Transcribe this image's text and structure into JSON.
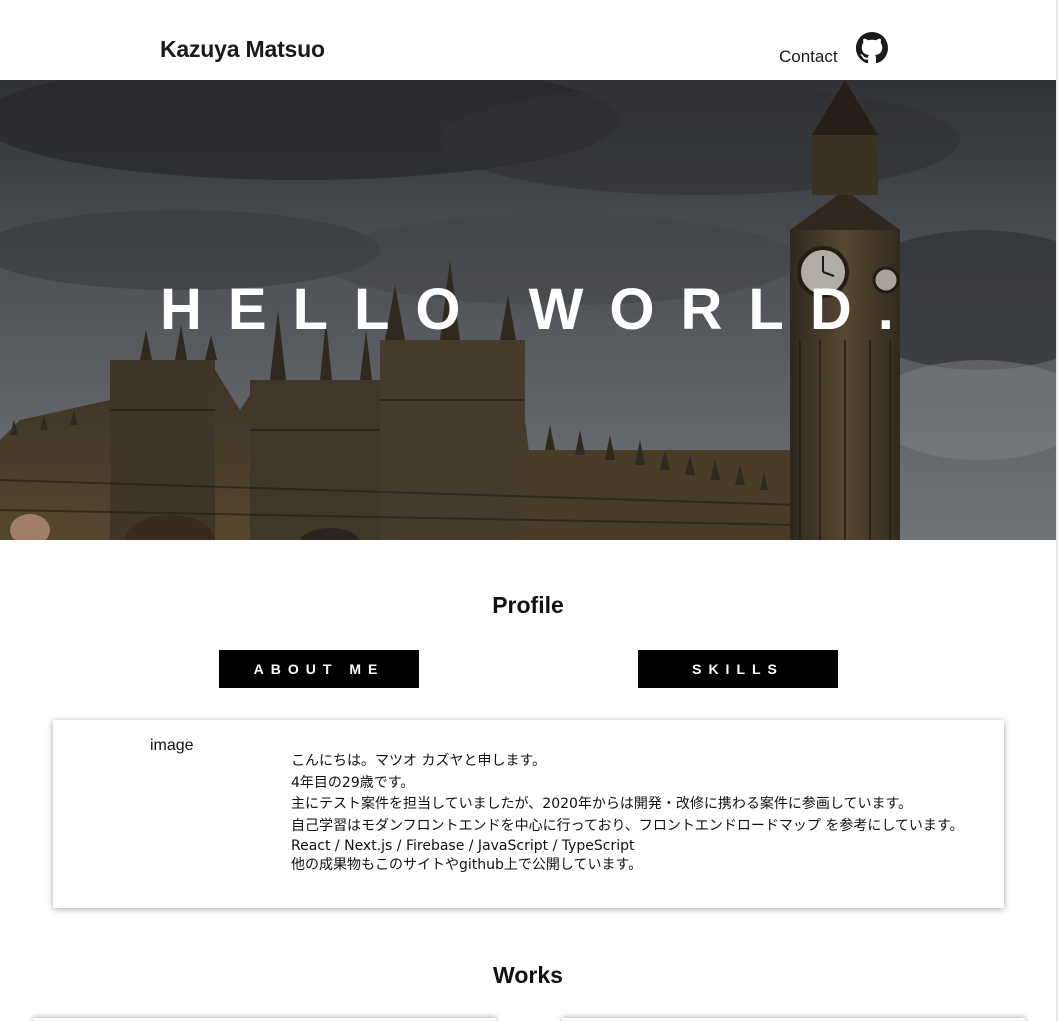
{
  "header": {
    "site_title": "Kazuya Matsuo",
    "nav": {
      "contact_label": "Contact"
    },
    "github_icon": "github-icon"
  },
  "hero": {
    "title": "HELLO WORLD."
  },
  "profile": {
    "title": "Profile",
    "tabs": [
      {
        "label": "ABOUT ME"
      },
      {
        "label": "SKILLS"
      }
    ],
    "card": {
      "image_label": "image",
      "lines": [
        "こんにちは。マツオ カズヤと申します。",
        "4年目の29歳です。",
        "主にテスト案件を担当していましたが、2020年からは開発・改修に携わる案件に参画しています。",
        "自己学習はモダンフロントエンドを中心に行っており、フロントエンドロードマップ を参考にしています。",
        "React / Next.js / Firebase / JavaScript / TypeScript",
        "他の成果物もこのサイトやgithub上で公開しています。"
      ]
    }
  },
  "works": {
    "title": "Works"
  },
  "colors": {
    "tab_background": "#000000",
    "tab_text": "#ffffff",
    "hero_text": "#ffffff"
  }
}
